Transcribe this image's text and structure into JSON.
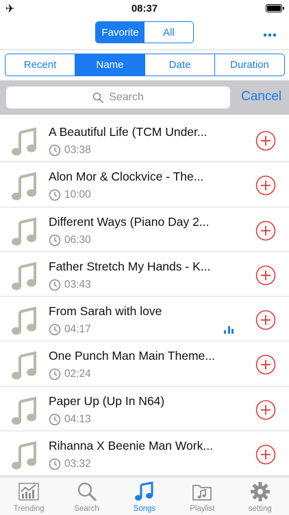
{
  "status_bar": {
    "time": "08:37"
  },
  "top_toggle": {
    "options": [
      "Favorite",
      "All"
    ],
    "selected": "Favorite"
  },
  "sort": {
    "options": [
      "Recent",
      "Name",
      "Date",
      "Duration"
    ],
    "selected": "Name"
  },
  "search": {
    "placeholder": "Search",
    "cancel_label": "Cancel"
  },
  "songs": [
    {
      "title": "A Beautiful Life (TCM Under...",
      "duration": "03:38"
    },
    {
      "title": "Alon Mor & Clockvice - The...",
      "duration": "10:00"
    },
    {
      "title": "Different Ways (Piano Day 2...",
      "duration": "06:30"
    },
    {
      "title": "Father Stretch My Hands - K...",
      "duration": "03:43"
    },
    {
      "title": "From Sarah with love",
      "duration": "04:17",
      "playing": true
    },
    {
      "title": "One Punch Man Main Theme...",
      "duration": "02:24"
    },
    {
      "title": "Paper Up (Up In N64)",
      "duration": "04:13"
    },
    {
      "title": "Rihanna X Beenie Man  Work...",
      "duration": "03:32"
    }
  ],
  "tabbar": {
    "tabs": [
      {
        "label": "Trending",
        "icon": "chart-icon"
      },
      {
        "label": "Search",
        "icon": "search-icon"
      },
      {
        "label": "Songs",
        "icon": "music-note-icon"
      },
      {
        "label": "Playlist",
        "icon": "playlist-folder-icon"
      },
      {
        "label": "setting",
        "icon": "gear-icon"
      }
    ],
    "selected": "Songs"
  },
  "colors": {
    "accent": "#1a7cf0",
    "add_red": "#e53935",
    "note_gray": "#b8b8a8"
  }
}
